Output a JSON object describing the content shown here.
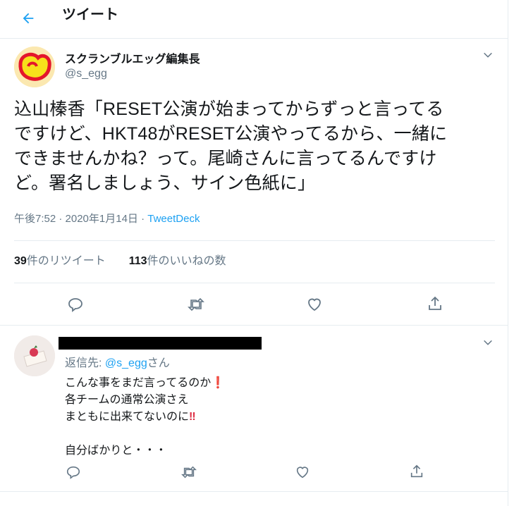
{
  "header": {
    "back_icon": "arrow-left-icon",
    "title": "ツイート"
  },
  "tweet": {
    "author_name": "スクランブルエッグ編集長",
    "author_handle": "@s_egg",
    "text_lines": [
      "込山榛香「RESET公演が始まってからずっと言ってる",
      "ですけど、HKT48がRESET公演やってるから、一緒に",
      "できませんかね？って。尾崎さんに言ってるんですけ",
      "ど。署名しましょう、サイン色紙に」"
    ],
    "time_date": "午後7:52 · 2020年1月14日 · ",
    "source": "TweetDeck",
    "retweet_count": "39",
    "retweet_label": "件のリツイート",
    "like_count": "113",
    "like_label": "件のいいねの数"
  },
  "reply": {
    "reply_prefix": "返信先: ",
    "reply_to": "@s_egg",
    "reply_suffix": "さん",
    "lines": [
      "こんな事をまだ言ってるのか",
      "各チームの通常公演さえ",
      "まともに出来てないのに",
      "",
      "自分ばかりと・・・"
    ],
    "emoji_1": "❗",
    "emoji_2": "‼"
  },
  "colors": {
    "accent": "#1da1f2",
    "muted": "#657786",
    "text": "#14171a",
    "border": "#e6ecf0"
  }
}
